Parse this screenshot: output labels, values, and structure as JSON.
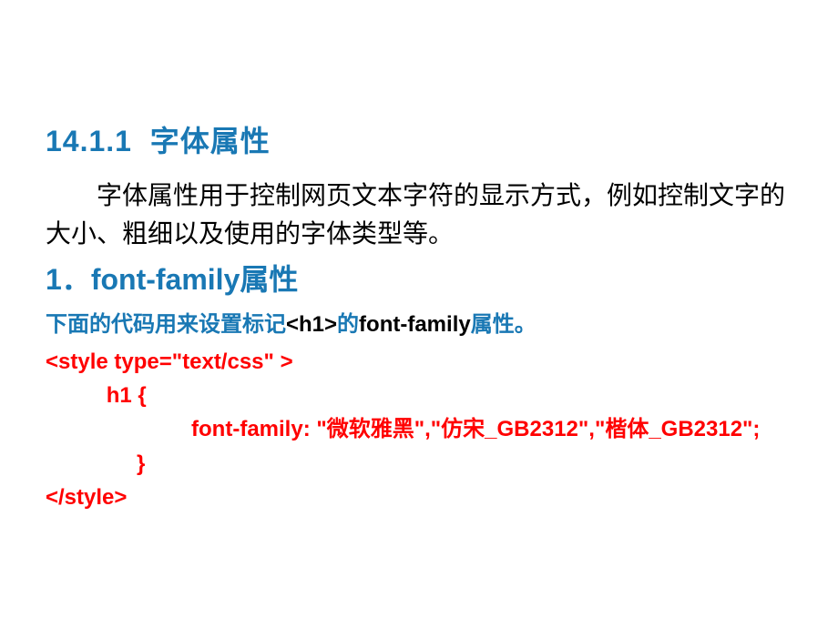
{
  "section": {
    "number": "14.1.1",
    "title": "字体属性"
  },
  "paragraph": "字体属性用于控制网页文本字符的显示方式，例如控制文字的大小、粗细以及使用的字体类型等。",
  "subheading": {
    "number": "1．",
    "title": "font-family属性"
  },
  "intro": {
    "prefix": "下面的代码用来设置标记",
    "tag": "<h1>",
    "mid": "的",
    "attr": "font-family",
    "suffix": "属性。"
  },
  "code": {
    "line1": "<style type=\"text/css\" >",
    "line2": "          h1 {",
    "line3": "                        font-family: \"微软雅黑\",\"仿宋_GB2312\",\"楷体_GB2312\";",
    "line4": "               }",
    "line5": "</style>"
  }
}
